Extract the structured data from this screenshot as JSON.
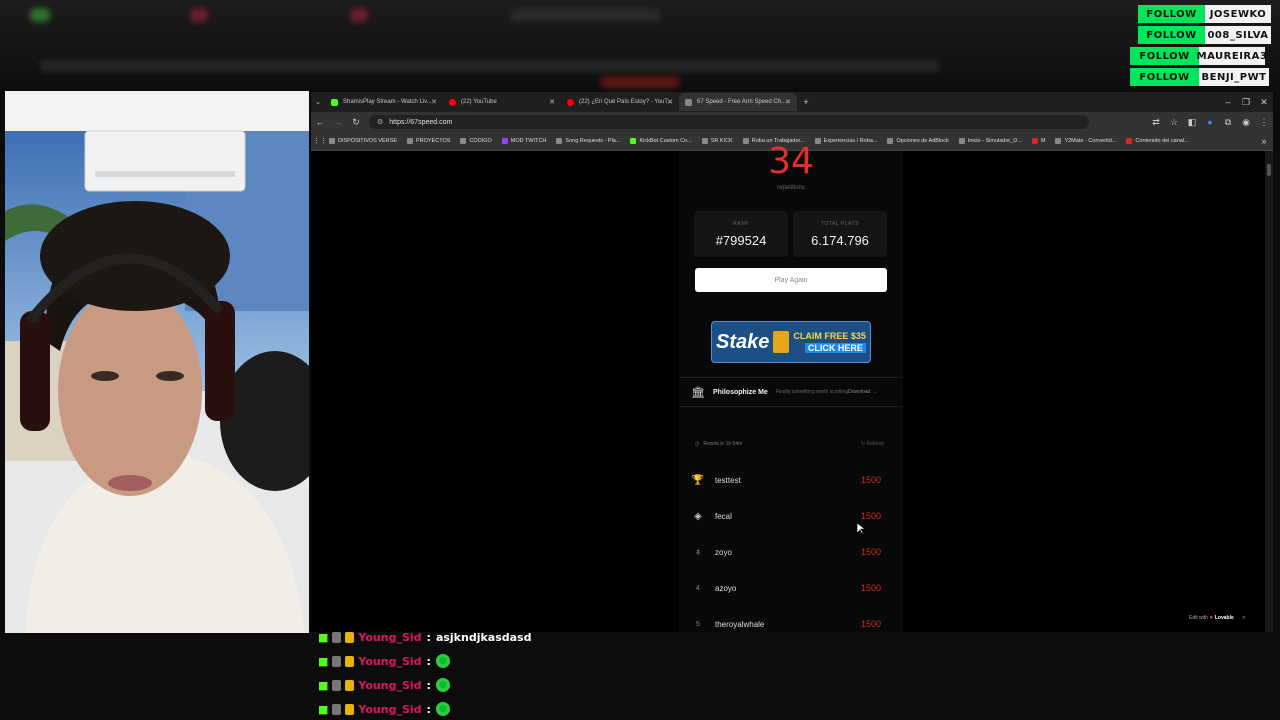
{
  "follow_alerts": [
    {
      "button": "FOLLOW",
      "name": "JOSEWKO"
    },
    {
      "button": "FOLLOW",
      "name": "008_SILVA"
    },
    {
      "button": "FOLLOW",
      "name": "MAUREIRA3"
    },
    {
      "button": "FOLLOW",
      "name": "BENJI_PWT"
    }
  ],
  "browser": {
    "tabs": [
      {
        "title": "ShamisPlay Stream - Watch Liv...",
        "icon": "kick-icon",
        "color": "#53fc18"
      },
      {
        "title": "(22) YouTube",
        "icon": "youtube-icon",
        "color": "#ff0000"
      },
      {
        "title": "(22) ¿En Qué País Estoy? - YouT...",
        "icon": "youtube-icon",
        "color": "#ff0000"
      },
      {
        "title": "67 Speed - Free Arm Speed Ch...",
        "icon": "site-icon",
        "color": "#888888"
      }
    ],
    "url": "https://67speed.com",
    "bookmarks": [
      "DISPOSITIVOS VERSE",
      "PROYECTOS",
      "CODIGO",
      "MOD TWITCH",
      "Song Requests - Pla...",
      "KickBot Custom Co...",
      "SR KICK",
      "Roba un Trabajador...",
      "Experiencias / Roba...",
      "Opciones de AdBlock",
      "Inicio - Simulador_D...",
      "M",
      "Y2Mate - Convertid...",
      "Contenido del canal..."
    ]
  },
  "game": {
    "reps": "34",
    "reps_label": "repetitions",
    "rank_label": "RANK",
    "rank": "#799524",
    "plays_label": "TOTAL PLAYS",
    "plays": "6.174.796",
    "play_again": "Play Again",
    "ad": {
      "brand": "Stake",
      "claim": "CLAIM FREE $35",
      "cta": "CLICK HERE"
    },
    "promo": {
      "name": "Philosophize Me",
      "tagline": "Finally something worth scrolling",
      "action": "Download →"
    },
    "reset_text": "Resets in 1h 54m",
    "refresh": "Refresh",
    "leaderboard": [
      {
        "rank": "",
        "name": "testtest",
        "score": "1500",
        "icon": "trophy-icon"
      },
      {
        "rank": "",
        "name": "fecal",
        "score": "1500",
        "icon": "medal-icon"
      },
      {
        "rank": "",
        "name": "zoyo",
        "score": "1500",
        "icon": "award-icon"
      },
      {
        "rank": "4",
        "name": "azoyo",
        "score": "1500",
        "icon": ""
      },
      {
        "rank": "5",
        "name": "theroyalwhale",
        "score": "1500",
        "icon": ""
      }
    ],
    "edit_with": "Edit with",
    "lovable": "Lovable"
  },
  "chat": [
    {
      "user": "Young_Sid",
      "message": "asjkndjkasdasd",
      "emote": false
    },
    {
      "user": "Young_Sid",
      "message": "",
      "emote": true
    },
    {
      "user": "Young_Sid",
      "message": "",
      "emote": true
    },
    {
      "user": "Young_Sid",
      "message": "",
      "emote": true
    }
  ]
}
